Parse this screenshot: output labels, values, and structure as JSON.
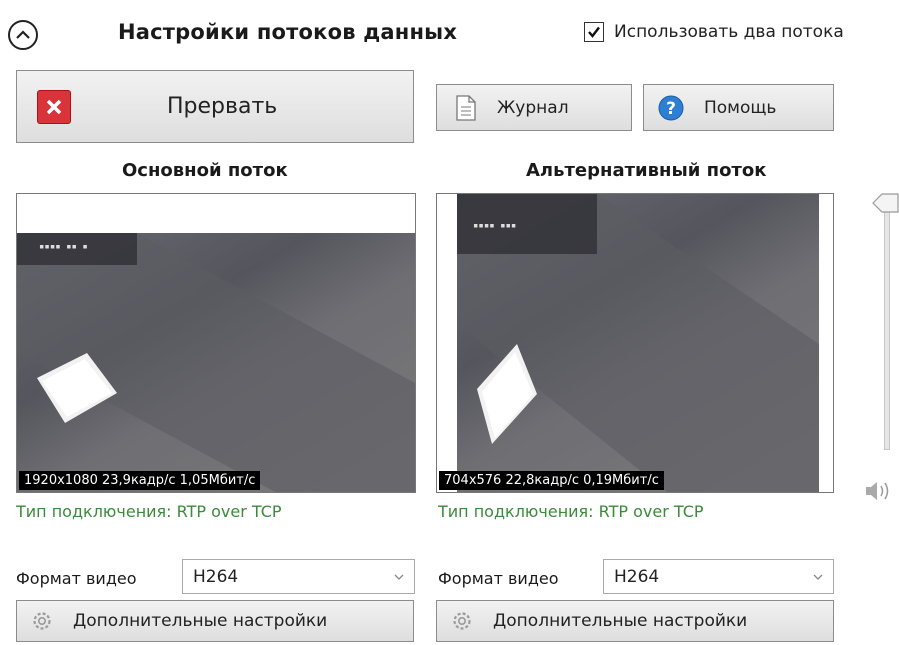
{
  "header": {
    "title": "Настройки потоков данных",
    "dual_stream_label": "Использовать два потока",
    "dual_stream_checked": true
  },
  "toolbar": {
    "abort_label": "Прервать",
    "journal_label": "Журнал",
    "help_label": "Помощь"
  },
  "main_stream": {
    "title": "Основной поток",
    "stats": "1920x1080  23,9кадр/с  1,05Мбит/с",
    "connection": "Тип подключения:  RTP over TCP",
    "format_label": "Формат видео",
    "format_value": "H264",
    "advanced_label": "Дополнительные настройки"
  },
  "alt_stream": {
    "title": "Альтернативный поток",
    "stats": "704x576  22,8кадр/с  0,19Мбит/с",
    "connection": "Тип подключения:  RTP over TCP",
    "format_label": "Формат видео",
    "format_value": "H264",
    "advanced_label": "Дополнительные настройки"
  },
  "volume": {
    "level": 1.0
  },
  "colors": {
    "accent_green": "#3c8a3c",
    "abort_red": "#d8343a",
    "help_blue": "#2d7fd3"
  }
}
